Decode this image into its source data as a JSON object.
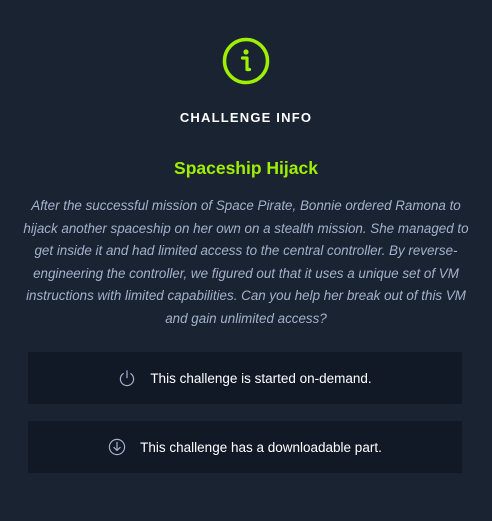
{
  "panel": {
    "heading": "CHALLENGE INFO",
    "icon": "info-icon",
    "accent_color": "#9fef00"
  },
  "challenge": {
    "name": "Spaceship Hijack",
    "description": "After the successful mission of Space Pirate, Bonnie ordered Ramona to hijack another spaceship on her own on a stealth mission. She managed to get inside it and had limited access to the central controller. By reverse-engineering the controller, we figured out that it uses a unique set of VM instructions with limited capabilities. Can you help her break out of this VM and gain unlimited access?"
  },
  "cards": [
    {
      "icon": "power-icon",
      "text": "This challenge is started on-demand."
    },
    {
      "icon": "download-icon",
      "text": "This challenge has a downloadable part."
    }
  ]
}
